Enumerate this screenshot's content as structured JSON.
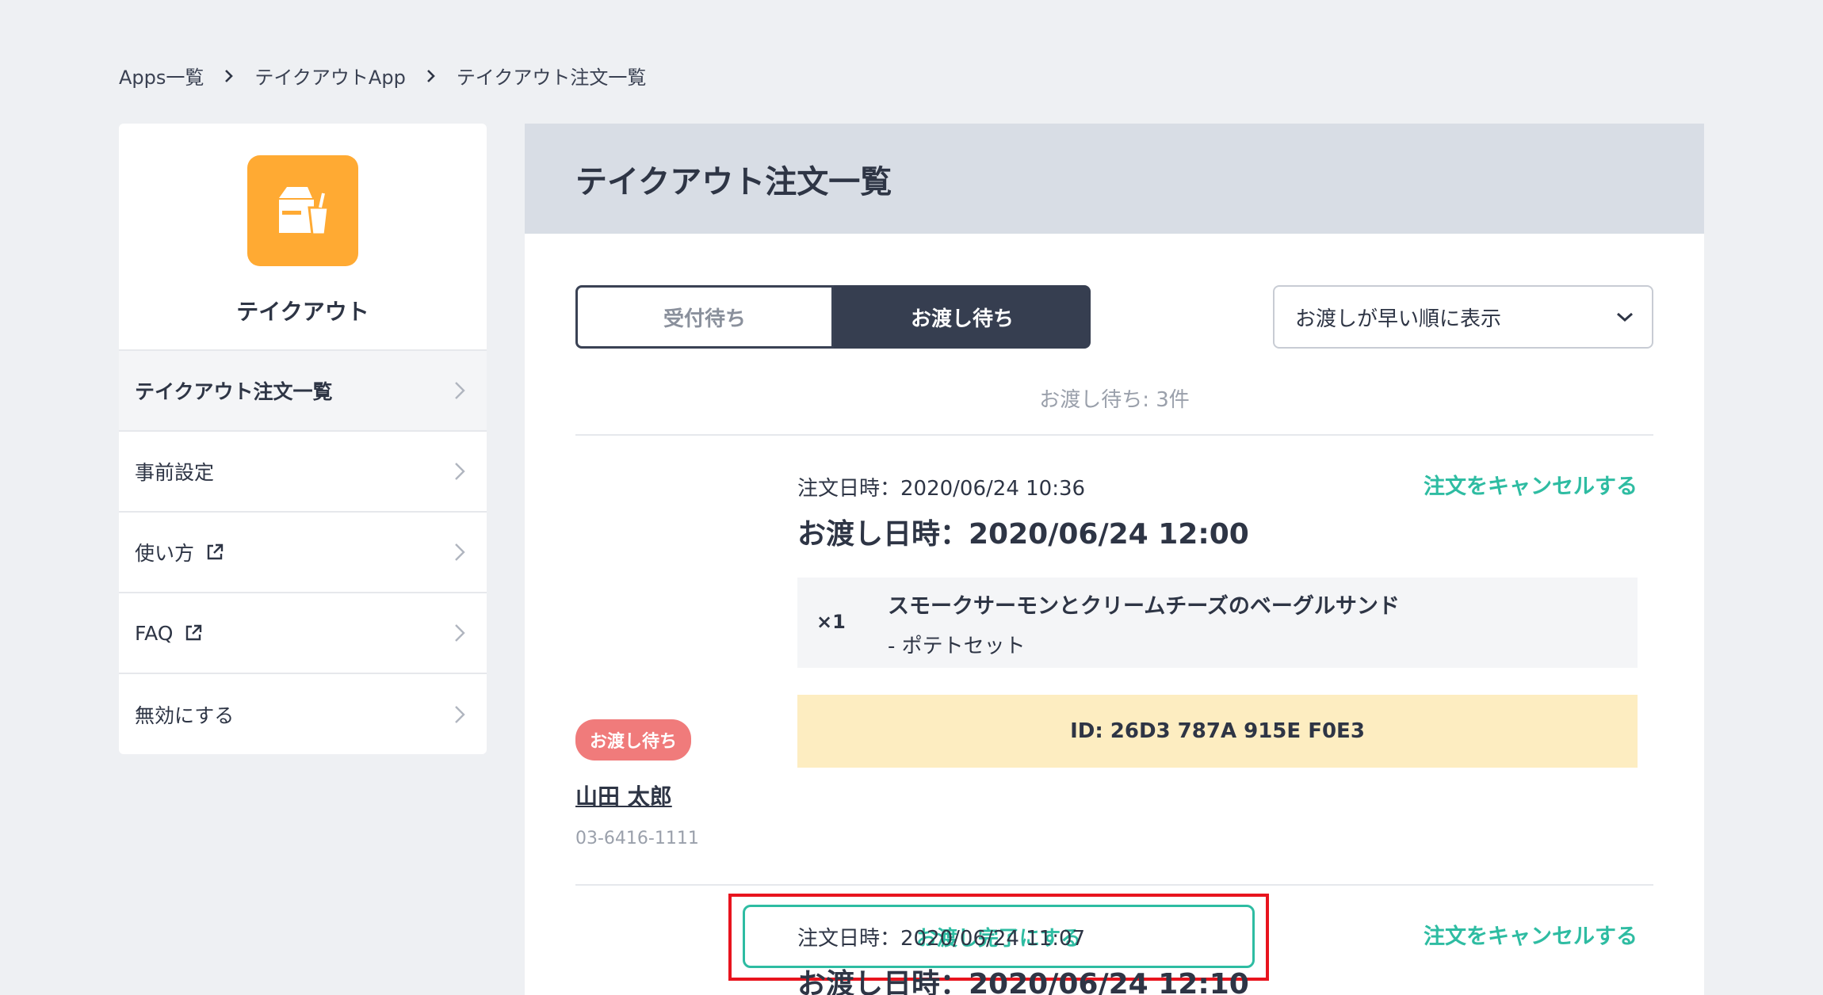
{
  "breadcrumb": [
    "Apps一覧",
    "テイクアウトApp",
    "テイクアウト注文一覧"
  ],
  "sidebar": {
    "app_name": "テイクアウト",
    "items": [
      {
        "label": "テイクアウト注文一覧",
        "external": false
      },
      {
        "label": "事前設定",
        "external": false
      },
      {
        "label": "使い方",
        "external": true
      },
      {
        "label": "FAQ",
        "external": true
      },
      {
        "label": "無効にする",
        "external": false
      }
    ]
  },
  "main": {
    "title": "テイクアウト注文一覧",
    "tabs": [
      "受付待ち",
      "お渡し待ち"
    ],
    "active_tab": "お渡し待ち",
    "sort_label": "お渡しが早い順に表示",
    "count_text": "お渡し待ち: 3件"
  },
  "orders": [
    {
      "status": "お渡し待ち",
      "customer_name": "山田 太郎",
      "phone": "03-6416-1111",
      "order_date": "注文日時：2020/06/24 10:36",
      "handoff_date": "お渡し日時：2020/06/24 12:00",
      "cancel_label": "注文をキャンセルする",
      "quantity": "×1",
      "item_name": "スモークサーモンとクリームチーズのベーグルサンド",
      "item_option": "-  ポテトセット",
      "id_text": "ID: 26D3  787A  915E  F0E3",
      "complete_label": "お渡し完了にする"
    },
    {
      "order_date": "注文日時：2020/06/24 11:07",
      "handoff_date": "お渡し日時：2020/06/24 12:10",
      "cancel_label": "注文をキャンセルする"
    }
  ],
  "colors": {
    "accent": "#2ebca2",
    "app_icon": "#ffaa33",
    "badge": "#f07b7b",
    "highlight": "#e8141e"
  }
}
